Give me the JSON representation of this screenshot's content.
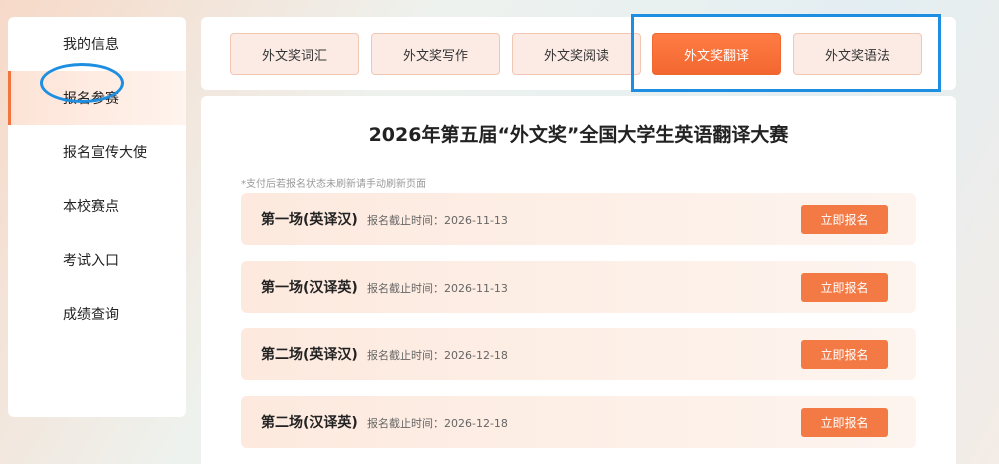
{
  "sidebar": {
    "items": [
      {
        "label": "我的信息"
      },
      {
        "label": "报名参赛"
      },
      {
        "label": "报名宣传大使"
      },
      {
        "label": "本校赛点"
      },
      {
        "label": "考试入口"
      },
      {
        "label": "成绩查询"
      }
    ],
    "active_index": 1
  },
  "tabs": [
    {
      "label": "外文奖词汇"
    },
    {
      "label": "外文奖写作"
    },
    {
      "label": "外文奖阅读"
    },
    {
      "label": "外文奖翻译"
    },
    {
      "label": "外文奖语法"
    }
  ],
  "active_tab": 3,
  "main": {
    "title": "2026年第五届“外文奖”全国大学生英语翻译大赛",
    "note": "*支付后若报名状态未刷新请手动刷新页面",
    "rows": [
      {
        "title": "第一场(英译汉)",
        "deadline": "报名截止时间：2026-11-13",
        "button": "立即报名"
      },
      {
        "title": "第一场(汉译英)",
        "deadline": "报名截止时间：2026-11-13",
        "button": "立即报名"
      },
      {
        "title": "第二场(英译汉)",
        "deadline": "报名截止时间：2026-12-18",
        "button": "立即报名"
      },
      {
        "title": "第二场(汉译英)",
        "deadline": "报名截止时间：2026-12-18",
        "button": "立即报名"
      }
    ]
  },
  "colors": {
    "accent": "#f47a45",
    "highlight_outline": "#1d8ee0"
  }
}
